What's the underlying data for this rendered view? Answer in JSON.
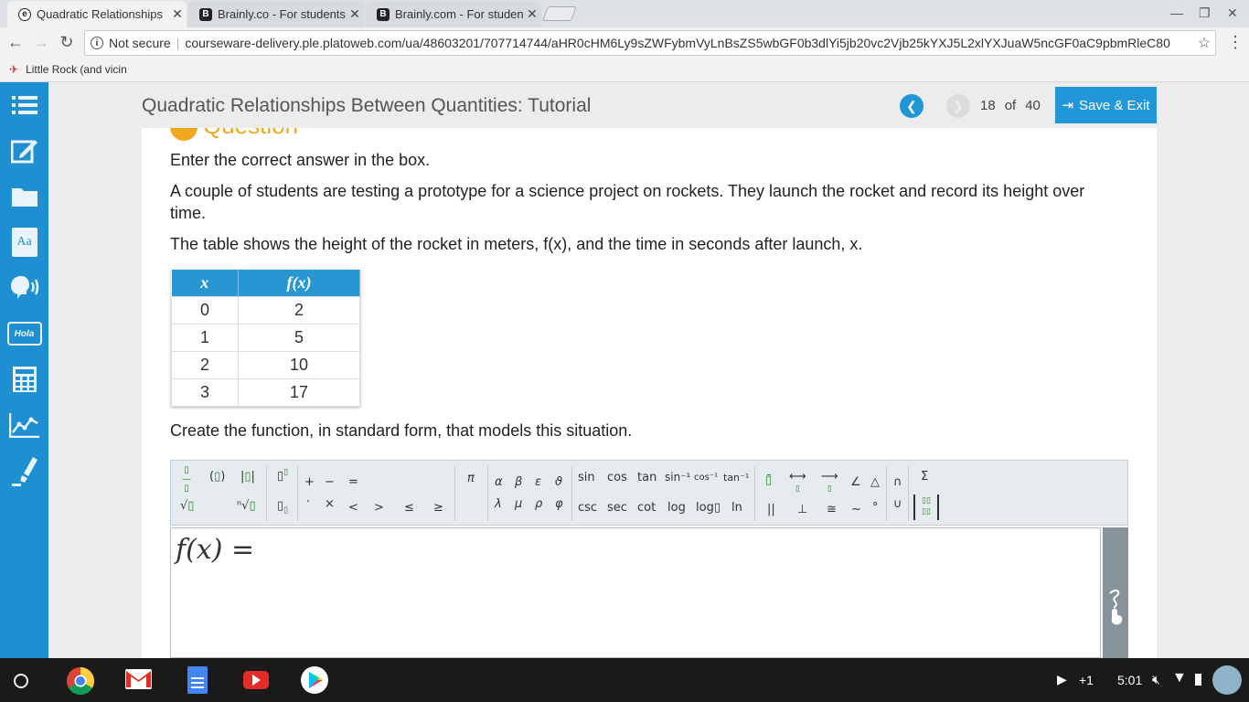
{
  "browser": {
    "tabs": [
      {
        "title": "Quadratic Relationships",
        "active": true
      },
      {
        "title": "Brainly.co - For students",
        "active": false
      },
      {
        "title": "Brainly.com - For student",
        "active": false
      }
    ],
    "security_label": "Not secure",
    "url": "courseware-delivery.ple.platoweb.com/ua/48603201/707714744/aHR0cHM6Ly9sZWFybmVyLnBsZS5wbGF0b3dlYi5jb20vc2Vjb25kYXJ5L2xlYXJuaW5ncGF0aC9pbmRleC80",
    "bookmark": "Little Rock (and vicin"
  },
  "app": {
    "title": "Quadratic Relationships Between Quantities: Tutorial",
    "page_current": "18",
    "page_of": "of",
    "page_total": "40",
    "save_exit_label": "Save & Exit",
    "question_heading": "Question",
    "sidebar_icons": [
      "list-icon",
      "edit-icon",
      "folder-icon",
      "dictionary-icon",
      "speaker-icon",
      "translate-icon",
      "calculator-icon",
      "graph-icon",
      "highlighter-icon"
    ],
    "hola_label": "Hola",
    "dict_label": "Aa"
  },
  "question": {
    "instruction": "Enter the correct answer in the box.",
    "p1": "A couple of students are testing a prototype for a science project on rockets. They launch the rocket and record its height over time.",
    "p2": "The table shows the height of the rocket in meters, f(x), and the time in seconds after launch, x.",
    "p3": "Create the function, in standard form, that models this situation.",
    "table": {
      "headers": [
        "x",
        "f(x)"
      ],
      "rows": [
        [
          "0",
          "2"
        ],
        [
          "1",
          "5"
        ],
        [
          "2",
          "10"
        ],
        [
          "3",
          "17"
        ]
      ]
    },
    "answer_prefix": "f(x) ="
  },
  "mathbar": {
    "trig_top": [
      "sin",
      "cos",
      "tan",
      "sin⁻¹",
      "cos⁻¹",
      "tan⁻¹"
    ],
    "trig_bottom": [
      "csc",
      "sec",
      "cot",
      "log",
      "log▯",
      "ln"
    ],
    "greek_top": [
      "α",
      "β",
      "ε",
      "ϑ"
    ],
    "greek_bottom": [
      "λ",
      "μ",
      "ρ",
      "φ"
    ],
    "ops_top": [
      "+",
      "−",
      "="
    ],
    "ops_bottom": [
      "·",
      "×",
      "<",
      ">",
      "≤",
      "≥"
    ],
    "pi": "π",
    "geo_top": [
      "∠",
      "△",
      "∩",
      "Σ"
    ],
    "geo_bottom": [
      "||",
      "⊥",
      "≅",
      "~",
      "°",
      "∪"
    ]
  },
  "taskbar": {
    "plus_one": "+1",
    "time": "5:01"
  }
}
